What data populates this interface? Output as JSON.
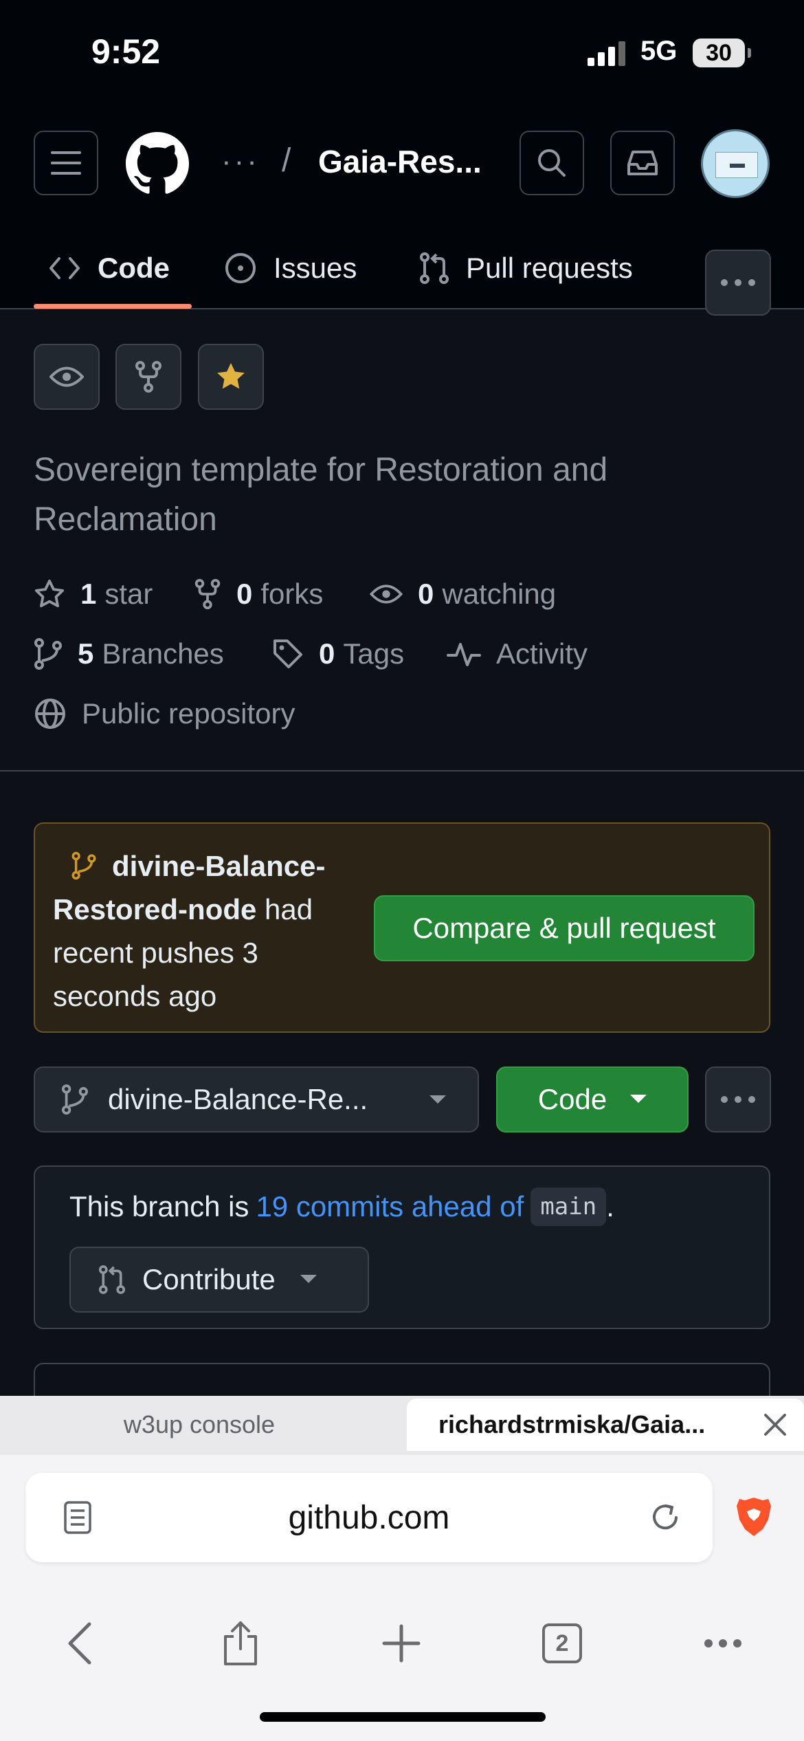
{
  "status_bar": {
    "time": "9:52",
    "network": "5G",
    "battery": "30"
  },
  "header": {
    "breadcrumb_ellipsis": "···",
    "breadcrumb_separator": "/",
    "repo_name": "Gaia-Res...",
    "tabs": [
      {
        "label": "Code",
        "icon": "code-icon",
        "active": true
      },
      {
        "label": "Issues",
        "icon": "issue-opened-icon",
        "active": false
      },
      {
        "label": "Pull requests",
        "icon": "git-pull-request-icon",
        "active": false
      }
    ]
  },
  "repo": {
    "description": "Sovereign template for Restoration and Reclamation",
    "stats": {
      "stars_count": "1",
      "stars_label": "star",
      "forks_count": "0",
      "forks_label": "forks",
      "watching_count": "0",
      "watching_label": "watching",
      "branches_count": "5",
      "branches_label": "Branches",
      "tags_count": "0",
      "tags_label": "Tags",
      "activity_label": "Activity",
      "visibility_label": "Public repository"
    }
  },
  "push_banner": {
    "branch": "divine-Balance-Restored-node",
    "message": " had recent pushes 3 seconds ago",
    "button_label": "Compare & pull request"
  },
  "branch_bar": {
    "branch_name": "divine-Balance-Re...",
    "code_button_label": "Code"
  },
  "ahead_box": {
    "prefix": "This branch is",
    "link_text": "19 commits ahead of",
    "base_branch": "main",
    "suffix": ".",
    "contribute_label": "Contribute"
  },
  "browser": {
    "tabs": [
      {
        "label": "w3up console",
        "active": false
      },
      {
        "label": "richardstrmiska/Gaia...",
        "active": true
      }
    ],
    "url": "github.com",
    "tab_count": "2"
  },
  "colors": {
    "background": "#0d1117",
    "accent_link": "#4493f8",
    "primary_button": "#238636",
    "tab_underline": "#fd8c73",
    "star_fill": "#e3b341",
    "banner_bg": "#2b2316"
  }
}
